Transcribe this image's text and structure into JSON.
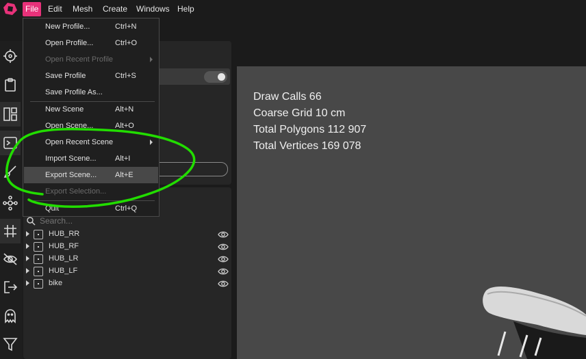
{
  "menubar": {
    "items": [
      "File",
      "Edit",
      "Mesh",
      "Create",
      "Windows",
      "Help"
    ],
    "active": "File",
    "accent_color": "#e8327a"
  },
  "file_menu": {
    "items": [
      {
        "label": "New Profile...",
        "shortcut": "Ctrl+N"
      },
      {
        "label": "Open Profile...",
        "shortcut": "Ctrl+O"
      },
      {
        "label": "Open Recent Profile",
        "shortcut": "",
        "disabled": true,
        "submenu": true
      },
      {
        "label": "Save Profile",
        "shortcut": "Ctrl+S"
      },
      {
        "label": "Save Profile As...",
        "shortcut": ""
      },
      {
        "label": "New Scene",
        "shortcut": "Alt+N"
      },
      {
        "label": "Open Scene...",
        "shortcut": "Alt+O"
      },
      {
        "label": "Open Recent Scene",
        "shortcut": "",
        "submenu": true
      },
      {
        "label": "Import Scene...",
        "shortcut": "Alt+I"
      },
      {
        "label": "Export Scene...",
        "shortcut": "Alt+E",
        "highlighted": true
      },
      {
        "label": "Export Selection...",
        "shortcut": "",
        "disabled": true
      },
      {
        "label": "Quit",
        "shortcut": "Ctrl+Q"
      }
    ]
  },
  "toolbar": {
    "icons": [
      "crosshair-icon",
      "clipboard-icon",
      "layout-icon",
      "terminal-icon",
      "brush-icon",
      "nodes-icon",
      "grid-icon",
      "eye-scan-icon",
      "exit-icon",
      "ghost-icon",
      "filter-icon"
    ]
  },
  "outliner": {
    "search_placeholder": "Search...",
    "nodes": [
      "HUB_RR",
      "HUB_RF",
      "HUB_LR",
      "HUB_LF",
      "bike"
    ]
  },
  "viewport": {
    "stats": [
      "Draw Calls 66",
      "Coarse Grid 10 cm",
      "Total Polygons 112 907",
      "Total Vertices 169 078"
    ]
  },
  "annotation_color": "#22dd00"
}
